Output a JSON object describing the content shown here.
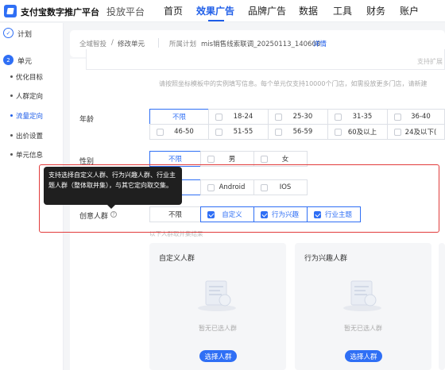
{
  "header": {
    "brand": "支付宝数字推广平台",
    "secondary": "投放平台",
    "nav": [
      "首页",
      "效果广告",
      "品牌广告",
      "数据",
      "工具",
      "财务",
      "账户"
    ],
    "active_nav": "效果广告"
  },
  "sidebar": {
    "step1": {
      "label": "计划",
      "icon": "check-icon"
    },
    "step2": {
      "number": "2",
      "label": "单元"
    },
    "items": [
      {
        "label": "优化目标"
      },
      {
        "label": "人群定向"
      },
      {
        "label": "流量定向"
      },
      {
        "label": "出价设置"
      },
      {
        "label": "单元信息"
      }
    ],
    "active_item": "流量定向"
  },
  "breadcrumb": {
    "root": "全域智投",
    "sep": "/",
    "current": "修改单元",
    "plan_prefix": "所属计划",
    "plan_name": "mis销售线索联调_20250113_140608",
    "detail_link": "详情"
  },
  "form": {
    "top_right_hint": "支持扩展",
    "store_hint": "请按照坐标模板中的实例填写信息。每个单元仅支持10000个门店，如需投放更多门店，请新建",
    "age": {
      "label": "年龄",
      "options_row1": [
        "不限",
        "18-24",
        "25-30",
        "31-35",
        "36-40"
      ],
      "options_row2": [
        "46-50",
        "51-55",
        "56-59",
        "60及以上",
        "24及以下("
      ],
      "selected": "不限"
    },
    "gender": {
      "label": "性别",
      "options": [
        "不限",
        "男",
        "女"
      ],
      "selected": "不限"
    },
    "os": {
      "options": [
        "Android",
        "IOS"
      ]
    },
    "crowd": {
      "label": "创意人群",
      "options": [
        "不限",
        "自定义",
        "行为兴趣",
        "行业主题"
      ],
      "checked": [
        "自定义",
        "行为兴趣",
        "行业主题"
      ],
      "sub_hint": "以下人群取并集结果"
    },
    "tooltip": "支持选择自定义人群、行为兴趣人群、行业主题人群（整体取并集），与其它定向取交集。"
  },
  "panels": [
    {
      "title": "自定义人群",
      "empty_text": "暂无已选人群",
      "button": "选择人群"
    },
    {
      "title": "行为兴趣人群",
      "empty_text": "暂无已选人群",
      "button": "选择人群"
    }
  ],
  "colors": {
    "accent": "#2f6ff5",
    "highlight_box": "#e23b3b"
  }
}
